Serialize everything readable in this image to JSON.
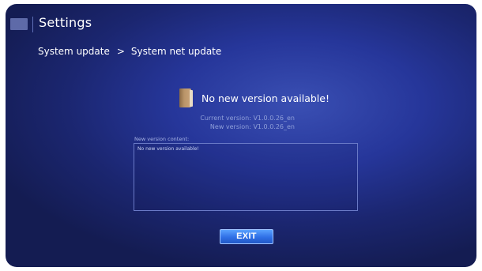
{
  "header": {
    "title": "Settings"
  },
  "breadcrumb": {
    "parent": "System update",
    "separator": ">",
    "current": "System net update"
  },
  "update_status": {
    "icon": "book-icon",
    "message": "No new version available!"
  },
  "versions": {
    "current_label": "Current version:",
    "current_value": "V1.0.0.26_en",
    "new_label": "New version:",
    "new_value": "V1.0.0.26_en"
  },
  "content": {
    "label": "New version content:",
    "text": "No new version available!"
  },
  "actions": {
    "exit_label": "EXIT"
  },
  "colors": {
    "background_center": "#3a4fb3",
    "background_edge": "#141c52",
    "accent_button": "#2f6fe6",
    "secondary_text": "#8f9fd9"
  }
}
